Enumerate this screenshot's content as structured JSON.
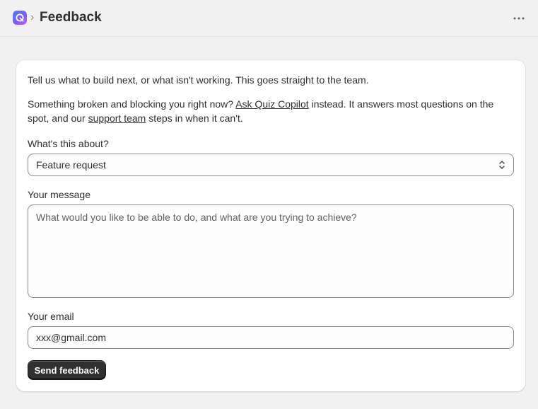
{
  "header": {
    "title": "Feedback",
    "separator": "›",
    "more_icon": "more-horizontal-icon",
    "more_glyph": "···",
    "logo_icon": "app-logo-icon"
  },
  "form": {
    "intro": "Tell us what to build next, or what isn't working. This goes straight to the team.",
    "para2_before": "Something broken and blocking you right now? ",
    "para2_link1": "Ask Quiz Copilot",
    "para2_middle": " instead. It answers most questions on the spot, and our ",
    "para2_link2": "support team",
    "para2_after": " steps in when it can't.",
    "topic_label": "What's this about?",
    "topic_value": "Feature request",
    "message_label": "Your message",
    "message_placeholder": "What would you like to be able to do, and what are you trying to achieve?",
    "email_label": "Your email",
    "email_value": "xxx@gmail.com",
    "submit_label": "Send feedback"
  },
  "colors": {
    "page_bg": "#f1f1f1",
    "card_bg": "#ffffff",
    "button_bg": "#303030",
    "text": "#303030"
  }
}
